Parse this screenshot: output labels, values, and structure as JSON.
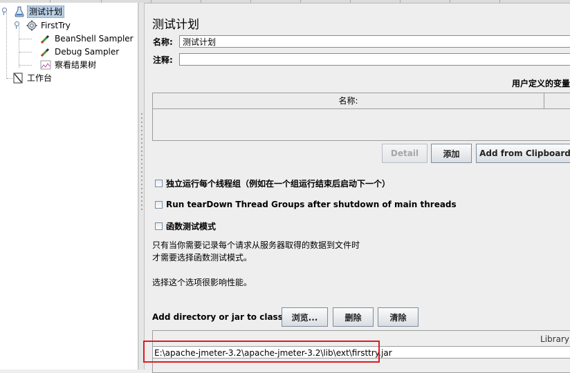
{
  "tree": {
    "items": [
      {
        "label": "测试计划",
        "icon": "test-plan-flask-icon",
        "selected": true
      },
      {
        "label": "FirstTry",
        "icon": "thread-group-gear-icon"
      },
      {
        "label": "BeanShell Sampler",
        "icon": "sampler-pipette-icon"
      },
      {
        "label": "Debug Sampler",
        "icon": "sampler-pipette-icon"
      },
      {
        "label": "察看结果树",
        "icon": "listener-graph-icon"
      },
      {
        "label": "工作台",
        "icon": "workbench-icon"
      }
    ]
  },
  "panel": {
    "title": "测试计划",
    "name_label": "名称:",
    "name_value": "测试计划",
    "comment_label": "注释:",
    "comment_value": "",
    "variables_title": "用户定义的变量",
    "variables_header_name": "名称:",
    "buttons": {
      "detail": "Detail",
      "add": "添加",
      "add_clipboard": "Add from Clipboard"
    },
    "checkboxes": [
      {
        "label": "独立运行每个线程组（例如在一个组运行结束后启动下一个）",
        "checked": false
      },
      {
        "label": "Run tearDown Thread Groups after shutdown of main threads",
        "checked": false
      },
      {
        "label": "函数测试模式",
        "checked": false
      }
    ],
    "note_line1": "只有当你需要记录每个请求从服务器取得的数据到文件时",
    "note_line2": "才需要选择函数测试模式。",
    "note_line3": "选择这个选项很影响性能。",
    "classpath": {
      "label": "Add directory or jar to classpath",
      "browse": "浏览...",
      "delete": "删除",
      "clear": "清除",
      "column_header": "Library",
      "rows": [
        "E:\\apache-jmeter-3.2\\apache-jmeter-3.2\\lib\\ext\\firsttry.jar"
      ]
    }
  },
  "colors": {
    "highlight_box": "#e0191f",
    "selection": "#b8cfe5"
  }
}
